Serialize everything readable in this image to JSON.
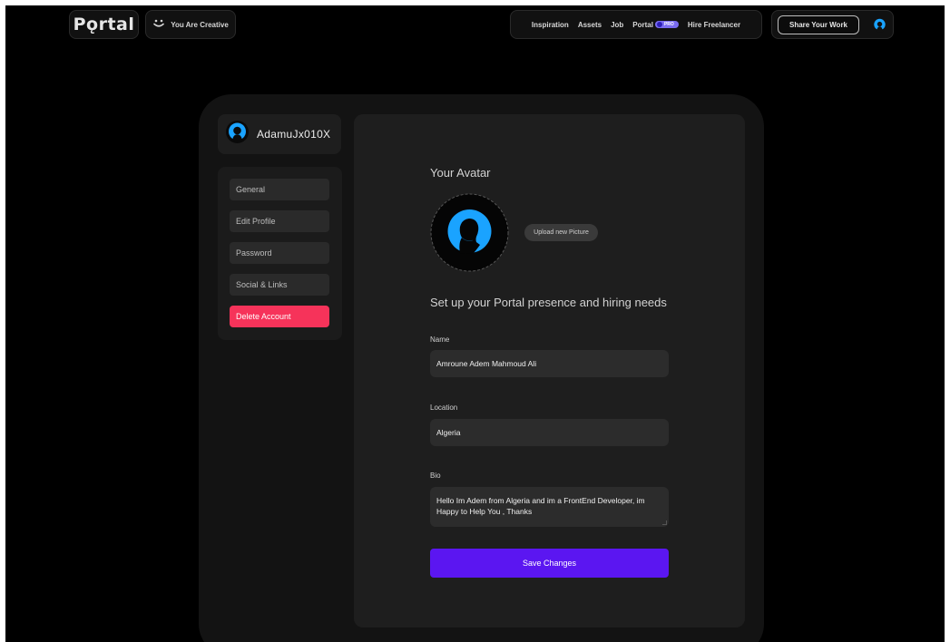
{
  "header": {
    "logo_text": "Pǫrtal",
    "tagline": "You Are Creative",
    "tagline_icon": "smile-icon",
    "nav": [
      "Inspiration",
      "Assets",
      "Job",
      "Portal",
      "Hire Freelancer"
    ],
    "pro_badge": "PRO",
    "share_label": "Share Your Work",
    "avatar_icon": "user-avatar-icon"
  },
  "sidebar": {
    "username": "AdamuJx010X",
    "items": [
      {
        "label": "General"
      },
      {
        "label": "Edit Profile"
      },
      {
        "label": "Password"
      },
      {
        "label": "Social & Links"
      },
      {
        "label": "Delete Account"
      }
    ]
  },
  "content": {
    "avatar_title": "Your Avatar",
    "upload_label": "Upload new Picture",
    "section_title": "Set up your Portal presence and hiring needs",
    "fields": {
      "name": {
        "label": "Name",
        "value": "Amroune Adem Mahmoud Ali"
      },
      "location": {
        "label": "Location",
        "value": "Algeria"
      },
      "bio": {
        "label": "Bio",
        "value": "Hello Im Adem from Algeria and im a FrontEnd Developer, im Happy to Help You , Thanks"
      }
    },
    "save_label": "Save Changes"
  },
  "colors": {
    "accent": "#5b16f1",
    "danger": "#f6335a",
    "avatar_blue": "#1aa3ff",
    "background": "#000000"
  }
}
